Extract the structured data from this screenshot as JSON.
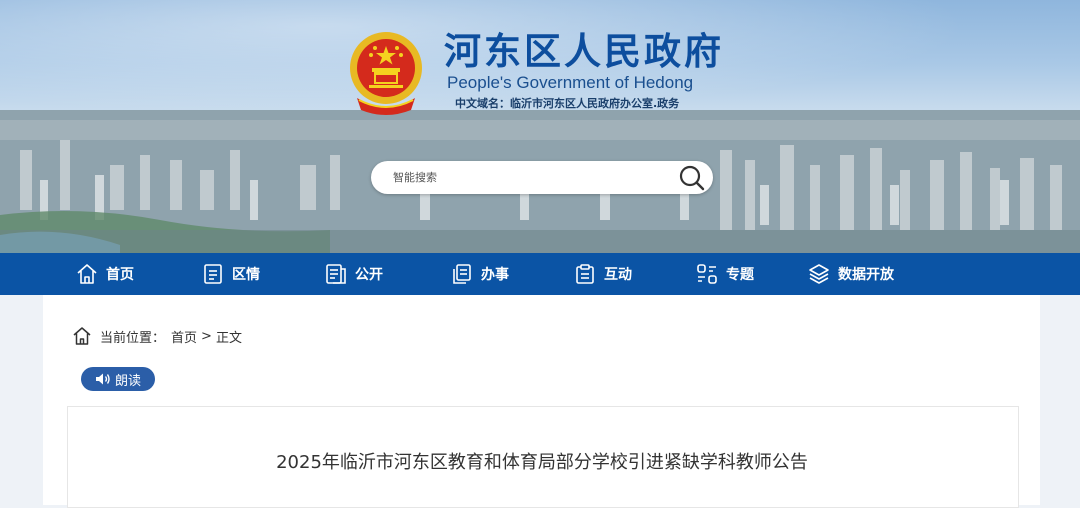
{
  "header": {
    "title": "河东区人民政府",
    "subtitle": "People's Government of Hedong",
    "domain_label": "中文域名：",
    "domain_value": "临沂市河东区人民政府办公室.政务"
  },
  "search": {
    "placeholder": "智能搜索"
  },
  "nav": {
    "items": [
      {
        "label": "首页",
        "icon": "home-icon"
      },
      {
        "label": "区情",
        "icon": "document-icon"
      },
      {
        "label": "公开",
        "icon": "list-document-icon"
      },
      {
        "label": "办事",
        "icon": "copy-document-icon"
      },
      {
        "label": "互动",
        "icon": "clipboard-icon"
      },
      {
        "label": "专题",
        "icon": "grid-icon"
      },
      {
        "label": "数据开放",
        "icon": "layers-icon"
      }
    ]
  },
  "breadcrumb": {
    "prefix": "当前位置：",
    "home": "首页",
    "separator": ">",
    "current": "正文"
  },
  "read_button": {
    "label": "朗读",
    "icon": "speaker-icon"
  },
  "article": {
    "title": "2025年临沂市河东区教育和体育局部分学校引进紧缺学科教师公告"
  },
  "colors": {
    "nav_bg": "#0b54a5",
    "title_blue": "#0d4e9e",
    "read_btn": "#2b5ea8"
  }
}
